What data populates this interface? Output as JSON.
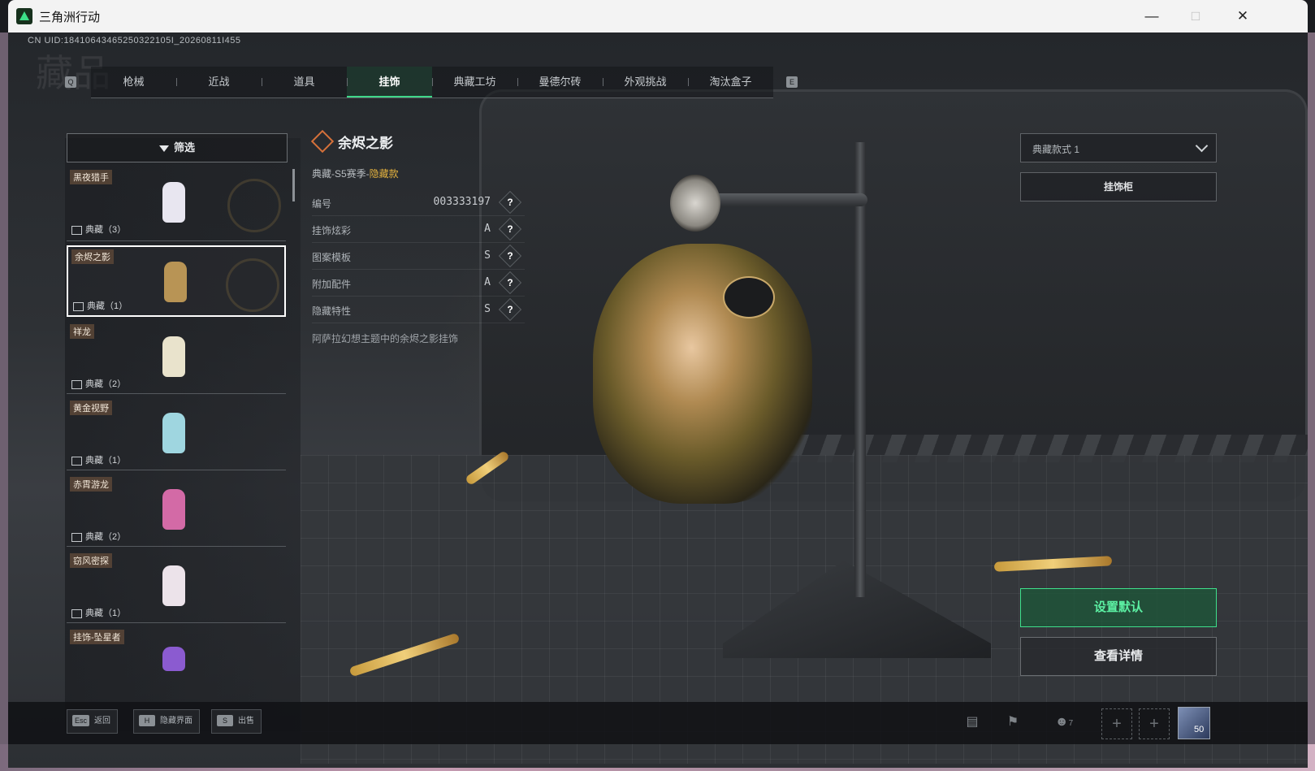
{
  "window": {
    "title": "三角洲行动"
  },
  "header": {
    "uid": "CN UID:18410643465250322105I_20260811I455",
    "watermark": "藏品"
  },
  "tabs": {
    "left_key": "Q",
    "right_key": "E",
    "items": [
      "枪械",
      "近战",
      "道具",
      "挂饰",
      "典藏工坊",
      "曼德尔砖",
      "外观挑战",
      "淘汰盒子"
    ],
    "active": "挂饰"
  },
  "filter": {
    "label": "筛选"
  },
  "list": [
    {
      "name": "黑夜猎手",
      "count": "典藏（3）",
      "color": "#e8e6f0"
    },
    {
      "name": "余烬之影",
      "count": "典藏（1）",
      "color": "#b89455",
      "selected": true
    },
    {
      "name": "祥龙",
      "count": "典藏（2）",
      "color": "#e9e3cc"
    },
    {
      "name": "黄金视野",
      "count": "典藏（1）",
      "color": "#9fd6e0"
    },
    {
      "name": "赤霄游龙",
      "count": "典藏（2）",
      "color": "#d36aa6"
    },
    {
      "name": "窃风密探",
      "count": "典藏（1）",
      "color": "#ece3ea"
    },
    {
      "name": "挂饰-坠星者",
      "count": "",
      "color": "#8b5bd0"
    }
  ],
  "info": {
    "title": "余烬之影",
    "season_prefix": "典藏-S5赛季-",
    "season_hidden": "隐藏款",
    "rows": [
      {
        "label": "编号",
        "value": "003333197"
      },
      {
        "label": "挂饰炫彩",
        "value": "A"
      },
      {
        "label": "图案模板",
        "value": "S"
      },
      {
        "label": "附加配件",
        "value": "A"
      },
      {
        "label": "隐藏特性",
        "value": "S"
      }
    ],
    "qmark": "?",
    "description": "阿萨拉幻想主题中的余烬之影挂饰"
  },
  "right": {
    "dropdown": "典藏款式 1",
    "cabinet": "挂饰柜",
    "set_default": "设置默认",
    "view_detail": "查看详情"
  },
  "bottom": {
    "hints": [
      {
        "key": "Esc",
        "label": "返回"
      },
      {
        "key": "H",
        "label": "隐藏界面"
      },
      {
        "key": "S",
        "label": "出售"
      }
    ],
    "party_count": "7",
    "avatar_level": "50"
  },
  "colors": {
    "accent": "#3ee08c",
    "hidden_gold": "#e4b23e",
    "tag_bg": "#5a4637"
  }
}
